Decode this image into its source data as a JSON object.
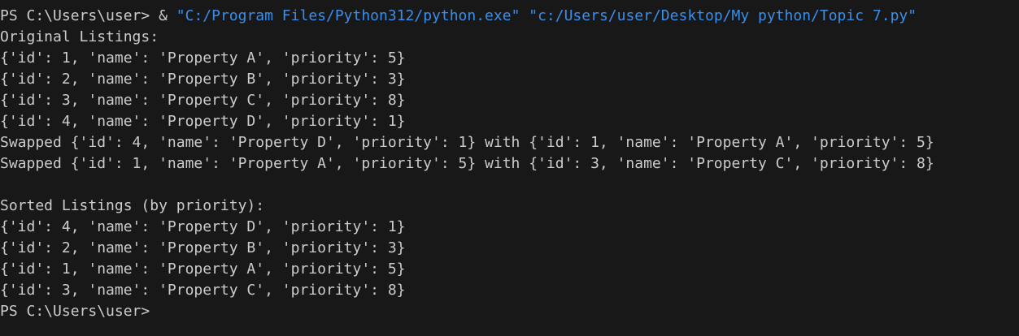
{
  "terminal": {
    "prompt_line": {
      "prompt": "PS C:\\Users\\user> ",
      "operator": "& ",
      "exe_path": "\"C:/Program Files/Python312/python.exe\"",
      "space": " ",
      "script_path": "\"c:/Users/user/Desktop/My python/Topic 7.py\""
    },
    "output_lines": [
      "Original Listings:",
      "{'id': 1, 'name': 'Property A', 'priority': 5}",
      "{'id': 2, 'name': 'Property B', 'priority': 3}",
      "{'id': 3, 'name': 'Property C', 'priority': 8}",
      "{'id': 4, 'name': 'Property D', 'priority': 1}",
      "Swapped {'id': 4, 'name': 'Property D', 'priority': 1} with {'id': 1, 'name': 'Property A', 'priority': 5}",
      "Swapped {'id': 1, 'name': 'Property A', 'priority': 5} with {'id': 3, 'name': 'Property C', 'priority': 8}",
      "",
      "Sorted Listings (by priority):",
      "{'id': 4, 'name': 'Property D', 'priority': 1}",
      "{'id': 2, 'name': 'Property B', 'priority': 3}",
      "{'id': 1, 'name': 'Property A', 'priority': 5}",
      "{'id': 3, 'name': 'Property C', 'priority': 8}"
    ],
    "final_prompt": "PS C:\\Users\\user>",
    "colors": {
      "background": "#181818",
      "text": "#cccccc",
      "string": "#3b8eea"
    }
  }
}
